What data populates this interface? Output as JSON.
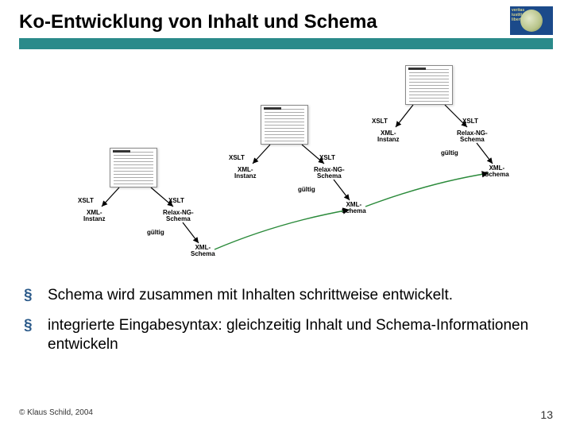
{
  "title": "Ko-Entwicklung von Inhalt und Schema",
  "logo": {
    "line1": "veritas",
    "line2": "iustitia",
    "line3": "libertas"
  },
  "labels": {
    "xslt": "XSLT",
    "gueltig": "gültig",
    "xml_instanz": "XML-\nInstanz",
    "relax_ng_schema": "Relax-NG-\nSchema",
    "xml_schema": "XML-\nSchema"
  },
  "bullets": [
    "Schema wird zusammen mit Inhalten schrittweise entwickelt.",
    "integrierte Eingabesyntax: gleichzeitig Inhalt und Schema-Informationen entwickeln"
  ],
  "footer": {
    "copyright": "© Klaus Schild, 2004",
    "page": "13"
  }
}
